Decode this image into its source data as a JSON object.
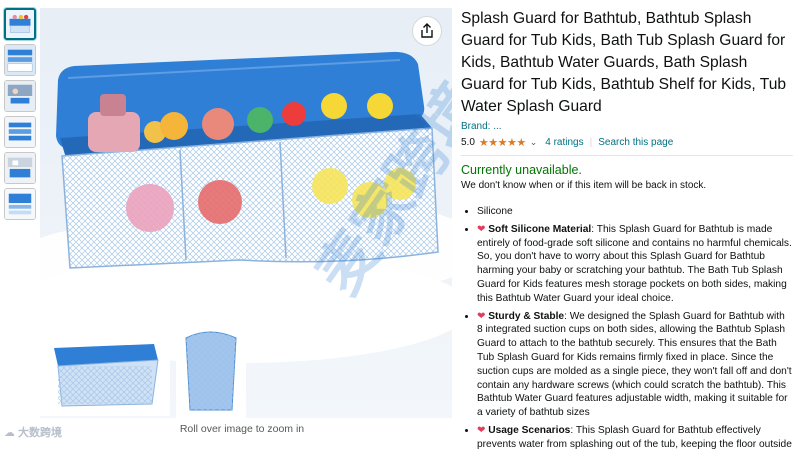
{
  "thumbnails": [
    {
      "name": "thumbnail-1"
    },
    {
      "name": "thumbnail-2"
    },
    {
      "name": "thumbnail-3"
    },
    {
      "name": "thumbnail-4"
    },
    {
      "name": "thumbnail-5"
    },
    {
      "name": "thumbnail-6"
    }
  ],
  "main_image": {
    "zoom_hint": "Roll over image to zoom in",
    "share_icon": "share-icon",
    "watermark_text": "大数跨境"
  },
  "product": {
    "title": "Splash Guard for Bathtub, Bathtub Splash Guard for Tub Kids, Bath Tub Splash Guard for Kids, Bathtub Water Guards, Bath Splash Guard for Tub Kids, Bathtub Shelf for Kids, Tub Water Splash Guard",
    "brand": "Brand: ...",
    "rating_value": "5.0",
    "stars": "★★★★★",
    "ratings_count": "4 ratings",
    "separator": "|",
    "search_link": "Search this page"
  },
  "availability": {
    "status": "Currently unavailable.",
    "note": "We don't know when or if this item will be back in stock."
  },
  "bullets": [
    {
      "heading": "",
      "text": "Silicone"
    },
    {
      "heading": "Soft Silicone Material",
      "text": ": This Splash Guard for Bathtub is made entirely of food-grade soft silicone and contains no harmful chemicals. So, you don't have to worry about this Splash Guard for Bathtub harming your baby or scratching your bathtub. The Bath Tub Splash Guard for Kids features mesh storage pockets on both sides, making this Bathtub Water Guard your ideal choice."
    },
    {
      "heading": "Sturdy & Stable",
      "text": ": We designed the Splash Guard for Bathtub with 8 integrated suction cups on both sides, allowing the Bathtub Splash Guard to attach to the bathtub securely. This ensures that the Bath Tub Splash Guard for Kids remains firmly fixed in place. Since the suction cups are molded as a single piece, they won't fall off and don't contain any hardware screws (which could scratch the bathtub). This Bathtub Water Guard features adjustable width, making it suitable for a variety of bathtub sizes"
    },
    {
      "heading": "Usage Scenarios",
      "text": ": This Splash Guard for Bathtub effectively prevents water from splashing out of the tub, keeping the floor outside clean."
    }
  ],
  "colors": {
    "link": "#007185",
    "available_green": "#007600",
    "star_orange": "#de7921",
    "product_blue": "#2f7fd6",
    "heart_red": "#e23b5c"
  }
}
